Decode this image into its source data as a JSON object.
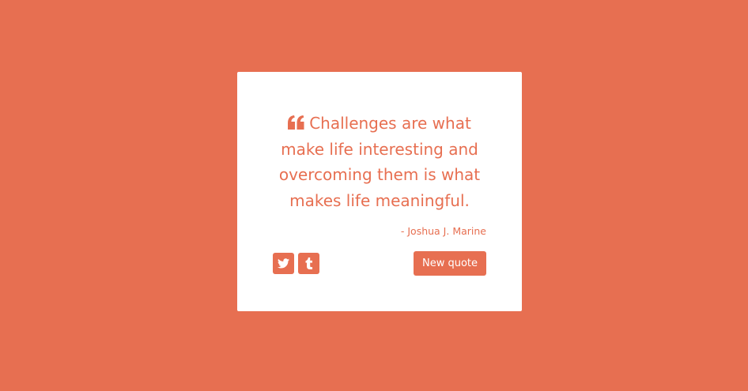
{
  "theme": {
    "accent_color": "#e76f51",
    "card_color": "#ffffff"
  },
  "quote": {
    "icon": "quote-left-icon",
    "text": "Challenges are what make life interesting and overcoming them is what makes life meaningful.",
    "author": "- Joshua J. Marine"
  },
  "actions": {
    "share_twitter_icon": "twitter-icon",
    "share_tumblr_icon": "tumblr-icon",
    "new_quote_label": "New quote"
  }
}
